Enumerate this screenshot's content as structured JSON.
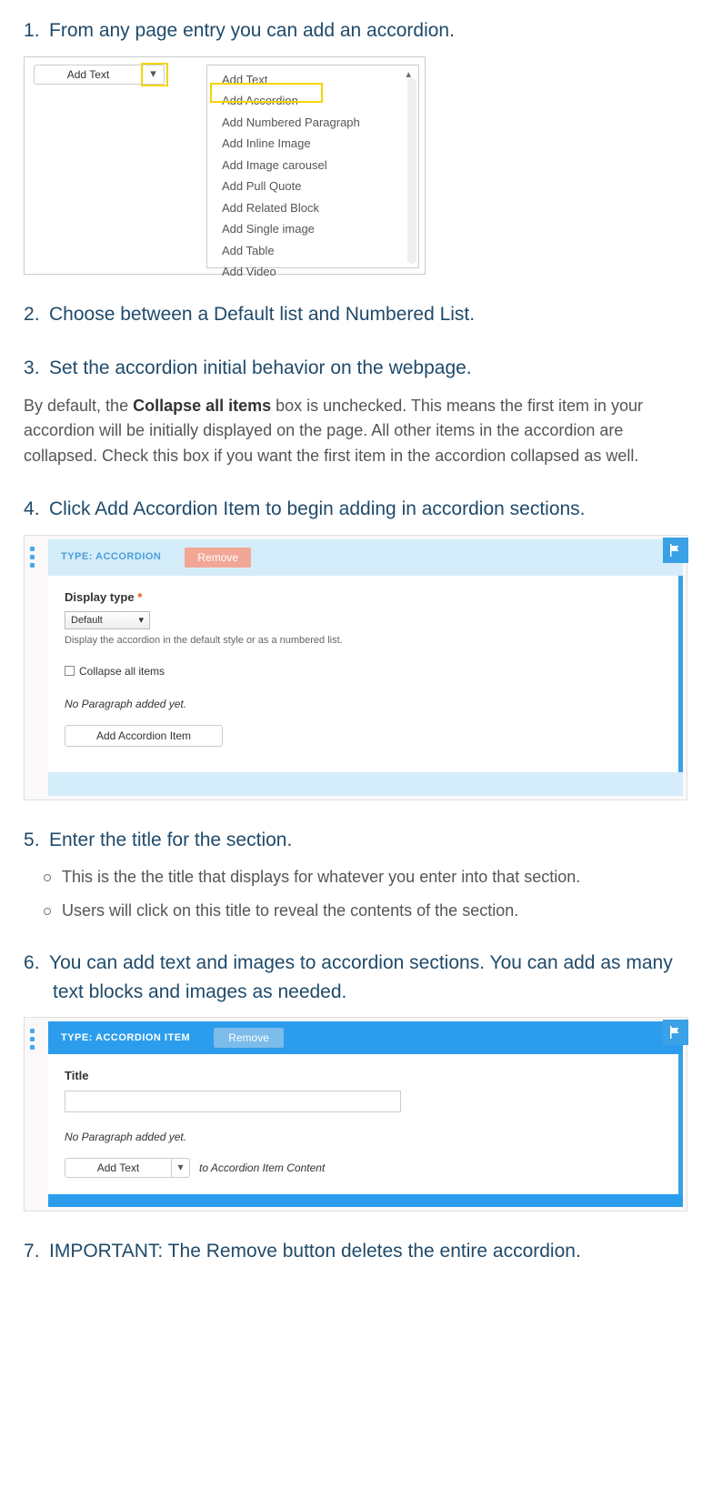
{
  "steps": {
    "s1": {
      "heading": "From any page entry you can add an accordion."
    },
    "s2": {
      "heading": "Choose between a Default list and Numbered List."
    },
    "s3": {
      "heading": "Set the accordion initial behavior on the webpage.",
      "body_pre": "By default, the ",
      "body_bold": "Collapse all items",
      "body_post": " box is unchecked.  This means the first item in your accordion will be initially displayed on the page.  All other items in the accordion are collapsed.  Check this box if you want the first item in the accordion collapsed as well."
    },
    "s4": {
      "heading": "Click Add Accordion Item to begin adding in accordion sections."
    },
    "s5": {
      "heading": "Enter the title for the section.",
      "sub1": "This is the the title that displays for whatever you enter into that section.",
      "sub2": "Users will click on this title to reveal the contents of the section."
    },
    "s6": {
      "heading": "You can add text and images to accordion sections. You can add as many text blocks and images as needed."
    },
    "s7": {
      "heading": "IMPORTANT: The Remove button deletes the entire accordion."
    }
  },
  "panel1": {
    "addtext_label": "Add Text",
    "menu": {
      "i0": "Add Text",
      "i1": "Add Accordion",
      "i2": "Add Numbered Paragraph",
      "i3": "Add Inline Image",
      "i4": "Add Image carousel",
      "i5": "Add Pull Quote",
      "i6": "Add Related Block",
      "i7": "Add Single image",
      "i8": "Add Table",
      "i9": "Add Video"
    }
  },
  "panel2": {
    "type_label": "TYPE: ACCORDION",
    "remove_label": "Remove",
    "display_type_label": "Display type",
    "asterisk": "*",
    "select_value": "Default",
    "help_text": "Display the accordion in the default style or as a numbered list.",
    "checkbox_label": "Collapse all items",
    "no_paragraph": "No Paragraph added yet.",
    "add_item_label": "Add Accordion Item"
  },
  "panel3": {
    "type_label": "TYPE: ACCORDION ITEM",
    "remove_label": "Remove",
    "title_label": "Title",
    "no_paragraph": "No Paragraph added yet.",
    "addtext_label": "Add Text",
    "to_label": "to Accordion Item Content"
  }
}
